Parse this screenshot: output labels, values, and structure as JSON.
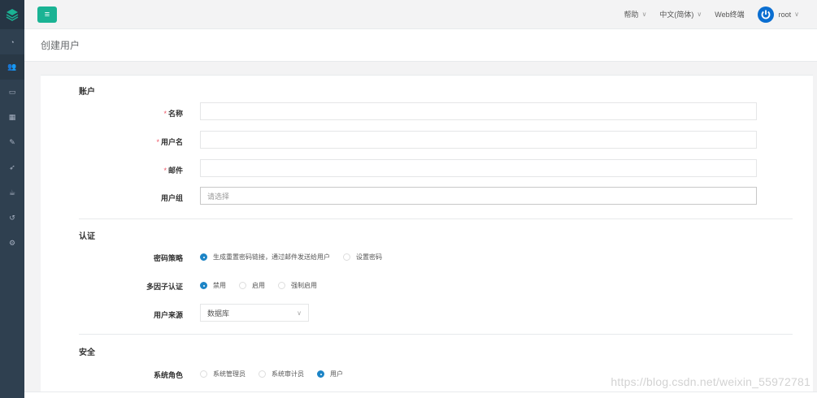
{
  "topbar": {
    "help": "帮助",
    "language": "中文(简体)",
    "web_terminal": "Web终端",
    "username": "root"
  },
  "page": {
    "title": "创建用户"
  },
  "sections": {
    "account": "账户",
    "auth": "认证",
    "security": "安全"
  },
  "form": {
    "name_label": "名称",
    "username_label": "用户名",
    "email_label": "邮件",
    "group_label": "用户组",
    "group_placeholder": "请选择",
    "required_mark": "*",
    "password_strategy_label": "密码策略",
    "password_strategy_options": [
      "生成重置密码链接，通过邮件发送给用户",
      "设置密码"
    ],
    "mfa_label": "多因子认证",
    "mfa_options": [
      "禁用",
      "启用",
      "强制启用"
    ],
    "source_label": "用户来源",
    "source_value": "数据库",
    "role_label": "系统角色",
    "role_options": [
      "系统管理员",
      "系统审计员",
      "用户"
    ]
  },
  "watermark": "https://blog.csdn.net/weixin_55972781",
  "colors": {
    "sidebar": "#2f4050",
    "accent": "#1ab394",
    "radio": "#1c84c6",
    "required": "#ed5565"
  }
}
